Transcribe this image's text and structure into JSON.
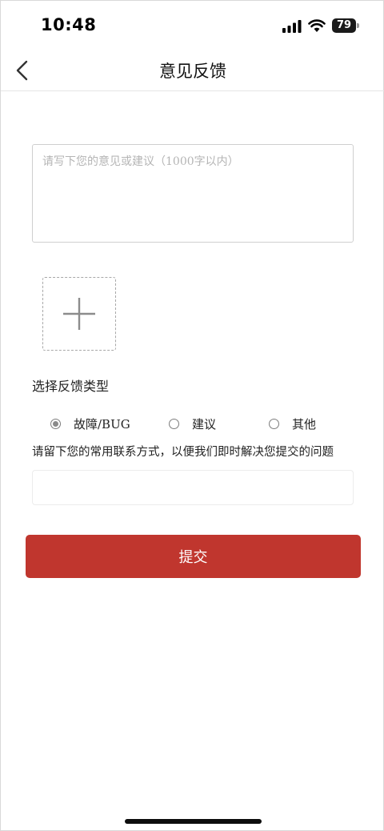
{
  "status_bar": {
    "time": "10:48",
    "battery_level": "79"
  },
  "header": {
    "title": "意见反馈",
    "back_icon": "chevron-left-icon"
  },
  "feedback": {
    "placeholder": "请写下您的意见或建议（1000字以内）",
    "value": "",
    "add_image_icon": "plus-icon"
  },
  "feedback_type": {
    "title": "选择反馈类型",
    "options": [
      {
        "label": "故障/BUG",
        "checked": true
      },
      {
        "label": "建议",
        "checked": false
      },
      {
        "label": "其他",
        "checked": false
      }
    ]
  },
  "contact": {
    "hint": "请留下您的常用联系方式，以便我们即时解决您提交的问题",
    "value": "",
    "placeholder": ""
  },
  "submit": {
    "label": "提交"
  },
  "colors": {
    "accent": "#c0362e",
    "text": "#222222",
    "placeholder": "#b5b5b5"
  }
}
